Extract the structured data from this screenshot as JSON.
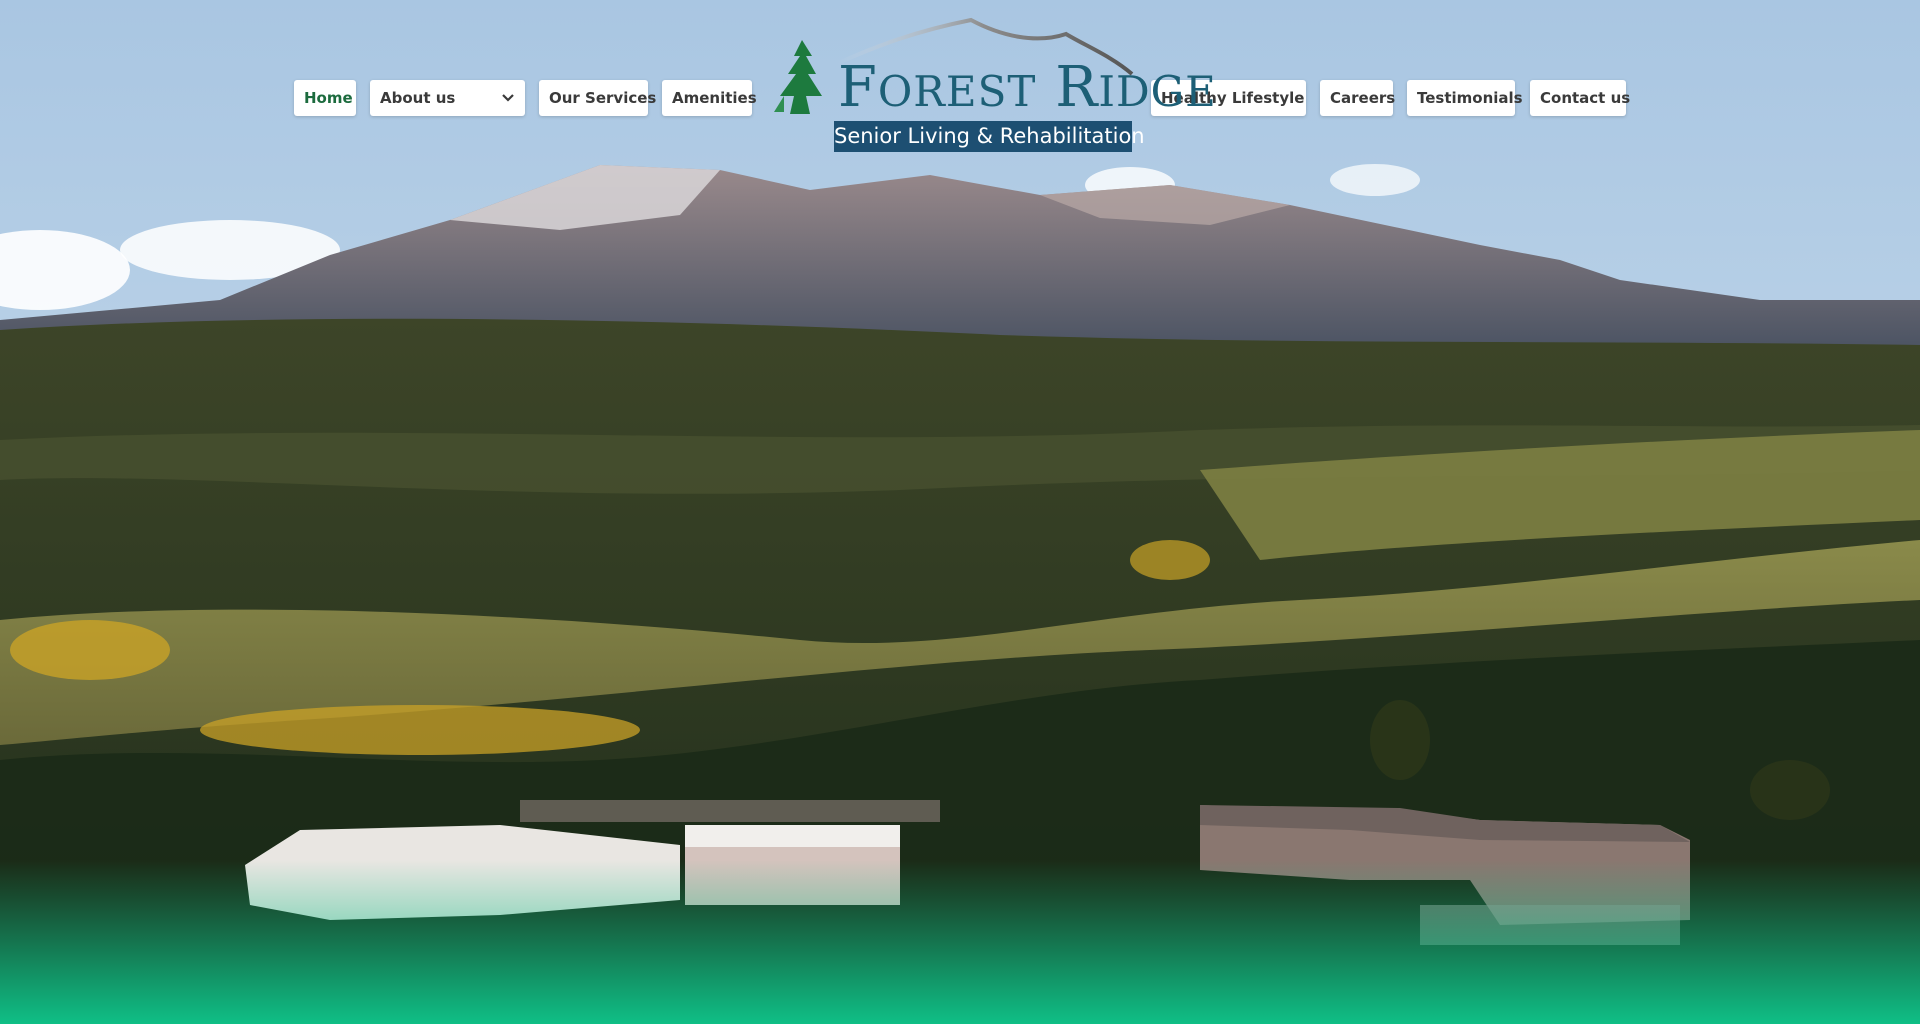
{
  "nav": {
    "home": "Home",
    "about": "About us",
    "services": "Our Services",
    "amenities": "Amenities",
    "healthy": "Healthy Lifestyle",
    "careers": "Careers",
    "testimonials": "Testimonials",
    "contact": "Contact us"
  },
  "logo": {
    "title_initial_1": "F",
    "title_rest_1": "OREST",
    "title_initial_2": "R",
    "title_rest_2": "IDGE",
    "subtitle": "Senior Living & Rehabilitation"
  },
  "colors": {
    "nav_active": "#1c6b3e",
    "logo_blue": "#1d5f76",
    "logo_banner": "#1d4f72",
    "footer_gradient": "#0fbf86"
  }
}
